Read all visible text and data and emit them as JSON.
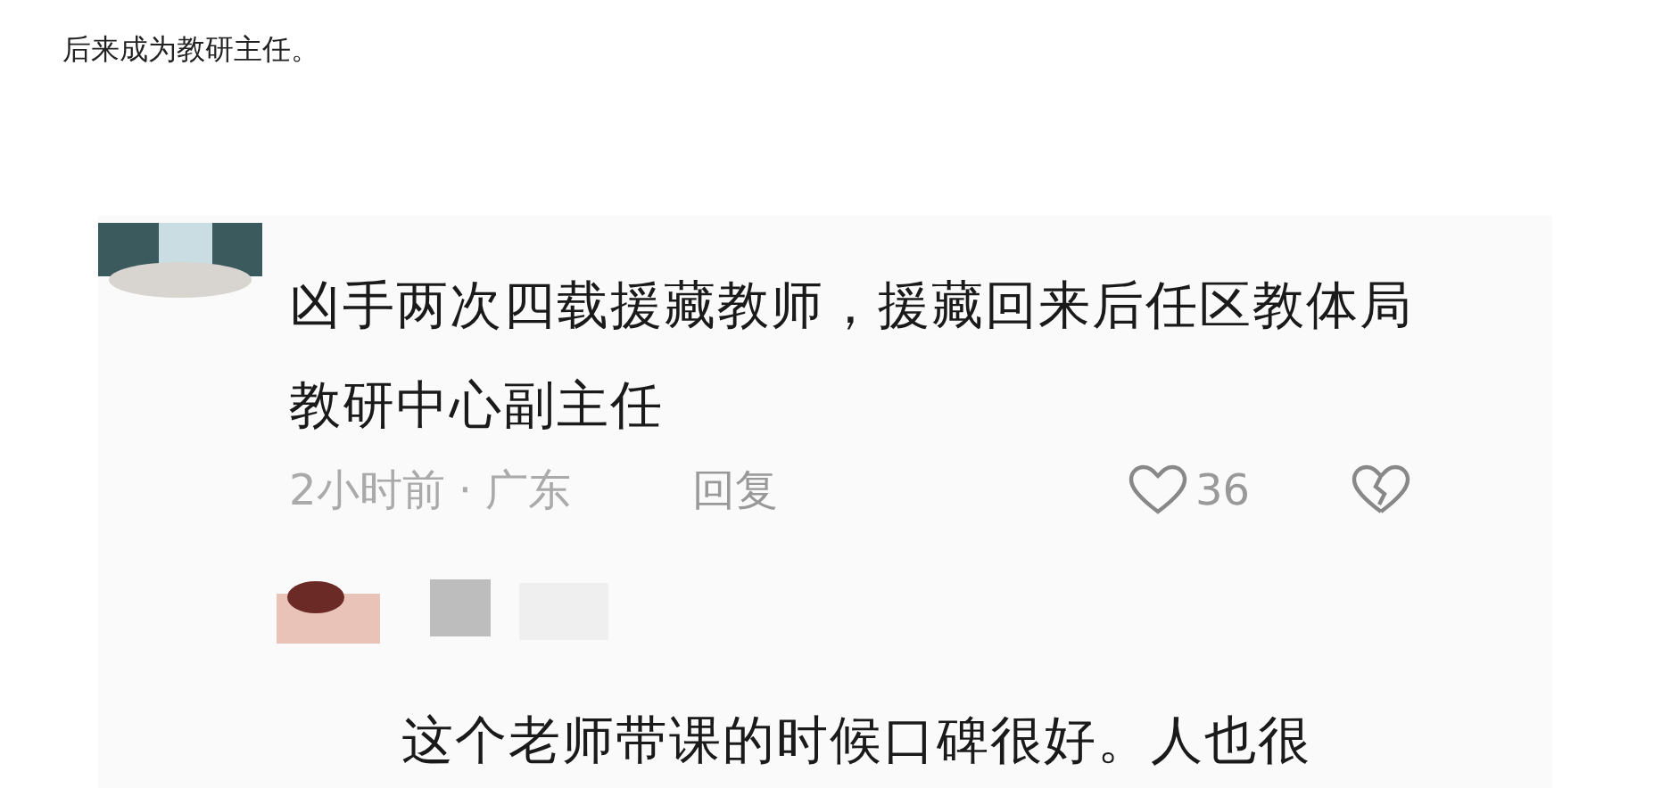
{
  "article": {
    "text": "后来成为教研主任。"
  },
  "comment": {
    "text": "凶手两次四载援藏教师，援藏回来后任区教体局教研中心副主任",
    "time_place": "2小时前 · 广东",
    "reply": "回复",
    "likes": "36"
  },
  "reply_comment": {
    "text": "这个老师带课的时候口碑很好。人也很"
  }
}
